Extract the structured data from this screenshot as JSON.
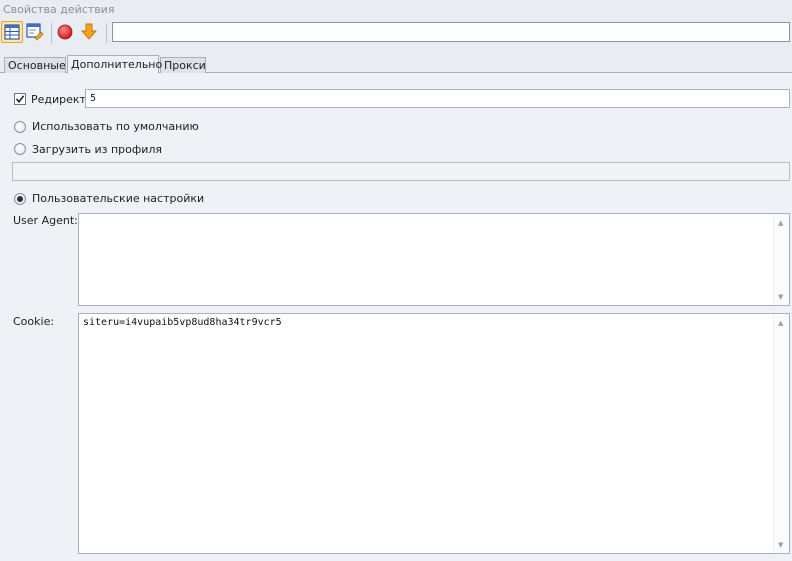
{
  "window": {
    "title": "Свойства действия"
  },
  "toolbar": {
    "action_value": ""
  },
  "tabs": [
    {
      "label": "Основные"
    },
    {
      "label": "Дополнительно"
    },
    {
      "label": "Прокси"
    }
  ],
  "redirect": {
    "label": "Редирект",
    "checked": true,
    "value": "5"
  },
  "options": {
    "default": {
      "label": "Использовать по умолчанию",
      "selected": false
    },
    "profile": {
      "label": "Загрузить из профиля",
      "selected": false,
      "value": ""
    },
    "custom": {
      "label": "Пользовательские настройки",
      "selected": true
    }
  },
  "user_agent": {
    "label": "User Agent:",
    "value": ""
  },
  "cookie": {
    "label": "Cookie:",
    "value": "siteru=i4vupaib5vp8ud8ha34tr9vcr5"
  },
  "colors": {
    "accent": "#ffe7a8",
    "stop": "#e02020",
    "arrow": "#f29a12"
  }
}
